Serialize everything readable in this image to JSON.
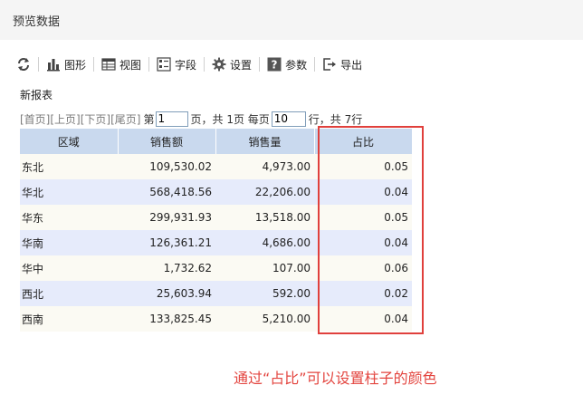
{
  "window": {
    "title": "预览数据"
  },
  "toolbar": {
    "refresh_label": "",
    "chart_label": "图形",
    "view_label": "视图",
    "field_label": "字段",
    "settings_label": "设置",
    "params_label": "参数",
    "export_label": "导出"
  },
  "report": {
    "name": "新报表"
  },
  "pager": {
    "first": "[首页]",
    "prev": "[上页]",
    "next": "[下页]",
    "last": "[尾页]",
    "page_prefix": "第",
    "page_value": "1",
    "page_suffix": "页，共 1页 每页",
    "size_value": "10",
    "size_suffix": "行，共 7行"
  },
  "table": {
    "headers": [
      "区域",
      "销售额",
      "销售量",
      "占比"
    ],
    "rows": [
      [
        "东北",
        "109,530.02",
        "4,973.00",
        "0.05"
      ],
      [
        "华北",
        "568,418.56",
        "22,206.00",
        "0.04"
      ],
      [
        "华东",
        "299,931.93",
        "13,518.00",
        "0.05"
      ],
      [
        "华南",
        "126,361.21",
        "4,686.00",
        "0.04"
      ],
      [
        "华中",
        "1,732.62",
        "107.00",
        "0.06"
      ],
      [
        "西北",
        "25,603.94",
        "592.00",
        "0.02"
      ],
      [
        "西南",
        "133,825.45",
        "5,210.00",
        "0.04"
      ]
    ]
  },
  "annotation": {
    "text": "通过“占比”可以设置柱子的颜色"
  },
  "colors": {
    "header_bg": "#c9d9ee",
    "row_odd": "#fbfaf3",
    "row_even": "#e6ebfb",
    "highlight": "#e0403c",
    "annotation": "#e3453f"
  }
}
